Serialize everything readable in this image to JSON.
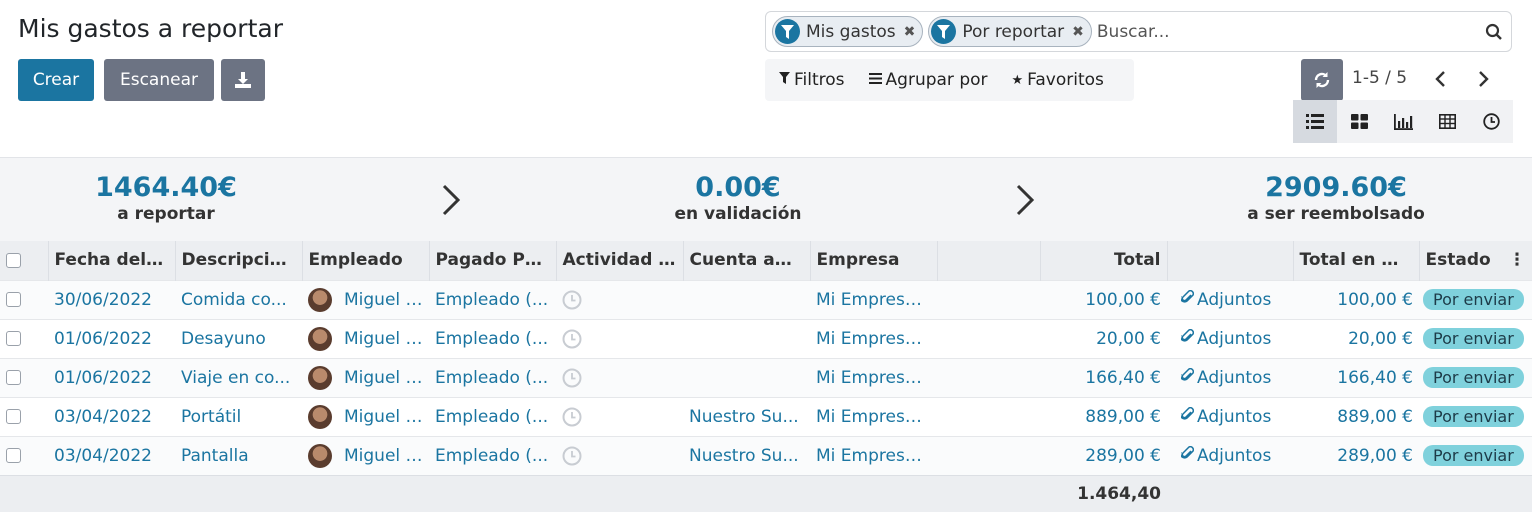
{
  "page_title": "Mis gastos a reportar",
  "buttons": {
    "crear": "Crear",
    "escanear": "Escanear"
  },
  "search": {
    "facets": [
      "Mis gastos",
      "Por reportar"
    ],
    "placeholder": "Buscar..."
  },
  "filters": {
    "filtros": "Filtros",
    "agrupar": "Agrupar por",
    "favoritos": "Favoritos"
  },
  "pager": {
    "value": "1-5 / 5"
  },
  "summary": [
    {
      "amount": "1464.40€",
      "label": "a reportar"
    },
    {
      "amount": "0.00€",
      "label": "en validación"
    },
    {
      "amount": "2909.60€",
      "label": "a ser reembolsado"
    }
  ],
  "table": {
    "headers": [
      "Fecha del ...",
      "Descripció...",
      "Empleado",
      "Pagado Po...",
      "Actividad s...",
      "Cuenta an...",
      "Empresa",
      "",
      "Total",
      "",
      "Total en m...",
      "Estado"
    ],
    "rows": [
      {
        "fecha": "30/06/2022",
        "desc": "Comida co...",
        "empleado": "Miguel Ad",
        "pagado": "Empleado (...",
        "cuenta": "",
        "empresa": "Mi Empresa...",
        "total": "100,00 €",
        "adjuntos": "Adjuntos",
        "total_m": "100,00 €",
        "estado": "Por enviar"
      },
      {
        "fecha": "01/06/2022",
        "desc": "Desayuno",
        "empleado": "Miguel Ad",
        "pagado": "Empleado (...",
        "cuenta": "",
        "empresa": "Mi Empresa...",
        "total": "20,00 €",
        "adjuntos": "Adjuntos",
        "total_m": "20,00 €",
        "estado": "Por enviar"
      },
      {
        "fecha": "01/06/2022",
        "desc": "Viaje en co...",
        "empleado": "Miguel Ad",
        "pagado": "Empleado (...",
        "cuenta": "",
        "empresa": "Mi Empresa...",
        "total": "166,40 €",
        "adjuntos": "Adjuntos",
        "total_m": "166,40 €",
        "estado": "Por enviar"
      },
      {
        "fecha": "03/04/2022",
        "desc": "Portátil",
        "empleado": "Miguel Ad",
        "pagado": "Empleado (...",
        "cuenta": "Nuestro Su...",
        "empresa": "Mi Empresa...",
        "total": "889,00 €",
        "adjuntos": "Adjuntos",
        "total_m": "889,00 €",
        "estado": "Por enviar"
      },
      {
        "fecha": "03/04/2022",
        "desc": "Pantalla",
        "empleado": "Miguel Ad",
        "pagado": "Empleado (...",
        "cuenta": "Nuestro Su...",
        "empresa": "Mi Empresa...",
        "total": "289,00 €",
        "adjuntos": "Adjuntos",
        "total_m": "289,00 €",
        "estado": "Por enviar"
      }
    ],
    "footer_total": "1.464,40"
  },
  "colors": {
    "primary": "#1b75a1",
    "secondary": "#6c7383",
    "badge": "#7fd1dc"
  }
}
